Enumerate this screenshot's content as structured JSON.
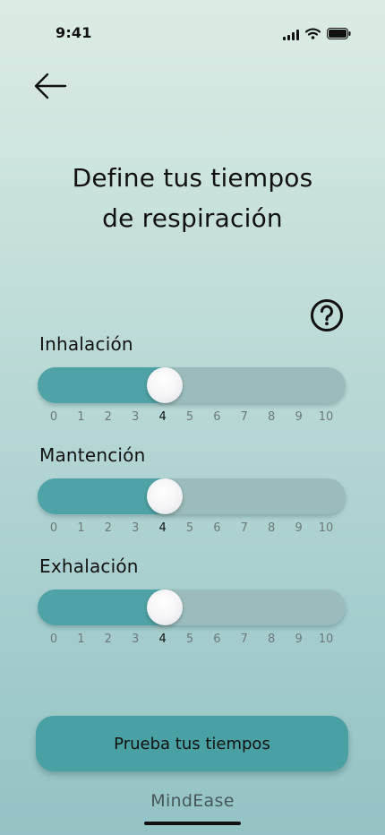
{
  "status_bar": {
    "time": "9:41"
  },
  "header": {
    "title_line1": "Define tus tiempos",
    "title_line2": "de respiración",
    "back_icon": "arrow-left-icon",
    "help_icon": "question-circle-icon"
  },
  "sliders": [
    {
      "label": "Inhalación",
      "value": 4,
      "min": 0,
      "max": 10
    },
    {
      "label": "Mantención",
      "value": 4,
      "min": 0,
      "max": 10
    },
    {
      "label": "Exhalación",
      "value": 4,
      "min": 0,
      "max": 10
    }
  ],
  "tick_labels": [
    "0",
    "1",
    "2",
    "3",
    "4",
    "5",
    "6",
    "7",
    "8",
    "9",
    "10"
  ],
  "actions": {
    "try_button_label": "Prueba tus tiempos"
  },
  "footer": {
    "brand": "MindEase"
  },
  "colors": {
    "track_fill": "#4fa3a6",
    "track_bg": "#9bbcbc",
    "button": "#4aa1a4"
  }
}
